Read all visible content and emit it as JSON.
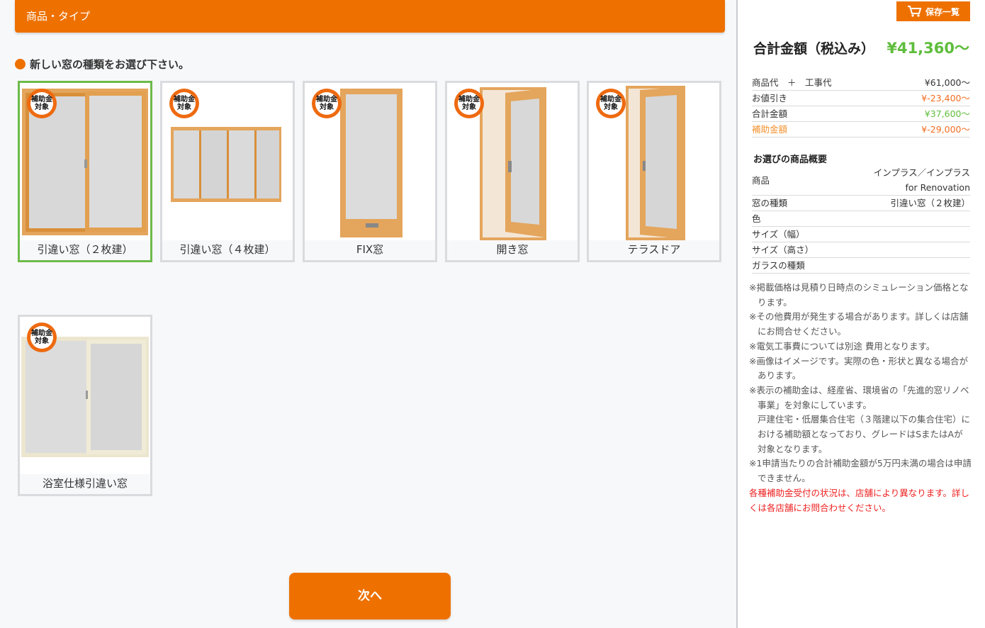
{
  "header": {
    "title": "商品・タイプ"
  },
  "prompt": "新しい窓の種類をお選び下さい。",
  "badge_text": "補助金\n対象",
  "window_types": [
    {
      "label": "引違い窓（２枚建）",
      "icon": "sliding-window-2panel",
      "selected": true,
      "badge": true
    },
    {
      "label": "引違い窓（４枚建）",
      "icon": "sliding-window-4panel",
      "selected": false,
      "badge": true
    },
    {
      "label": "FIX窓",
      "icon": "fixed-window",
      "selected": false,
      "badge": true
    },
    {
      "label": "開き窓",
      "icon": "casement-window",
      "selected": false,
      "badge": true
    },
    {
      "label": "テラスドア",
      "icon": "terrace-door",
      "selected": false,
      "badge": true
    },
    {
      "label": "浴室仕様引違い窓",
      "icon": "bathroom-sliding-window",
      "selected": false,
      "badge": true
    }
  ],
  "next_button": "次へ",
  "sidebar": {
    "save_button": "保存一覧",
    "total_label": "合計金額（税込み）",
    "total_value": "¥41,360〜",
    "price_rows": [
      {
        "label": "商品代　＋　工事代",
        "value": "¥61,000〜",
        "label_color": "#333333",
        "value_color": "#333333"
      },
      {
        "label": "お値引き",
        "value": "¥-23,400〜",
        "label_color": "#333333",
        "value_color": "#f26d21"
      },
      {
        "label": "合計金額",
        "value": "¥37,600〜",
        "label_color": "#333333",
        "value_color": "#5fbd3c"
      },
      {
        "label": "補助金額",
        "value": "¥-29,000〜",
        "label_color": "#f2922f",
        "value_color": "#f26d21"
      }
    ],
    "summary_title": "お選びの商品概要",
    "summary_rows": [
      {
        "label": "商品",
        "value": "インプラス／インプラス for Renovation"
      },
      {
        "label": "窓の種類",
        "value": "引違い窓（２枚建）"
      },
      {
        "label": "色",
        "value": ""
      },
      {
        "label": "サイズ（幅）",
        "value": ""
      },
      {
        "label": "サイズ（高さ）",
        "value": ""
      },
      {
        "label": "ガラスの種類",
        "value": ""
      }
    ],
    "notes": [
      "※掲載価格は見積り日時点のシミュレーション価格となります。",
      "※その他費用が発生する場合があります。詳しくは店舗にお問合せください。",
      "※電気工事費については別途 費用となります。",
      "※画像はイメージです。実際の色・形状と異なる場合があります。",
      "※表示の補助金は、経産省、環境省の「先進的窓リノベ事業」を対象にしています。",
      "戸建住宅・低層集合住宅（３階建以下の集合住宅）における補助額となっており、グレードはSまたはAが対象となります。",
      "※1申請当たりの合計補助金額が5万円未満の場合は申請できません。"
    ],
    "notice": "各種補助金受付の状況は、店舗により異なります。詳しくは各店舗にお問合わせください。"
  },
  "colors": {
    "accent": "#ee7100",
    "selected_border": "#6dbb4a",
    "total_green": "#5fbd3c",
    "notice_red": "#e22222"
  }
}
